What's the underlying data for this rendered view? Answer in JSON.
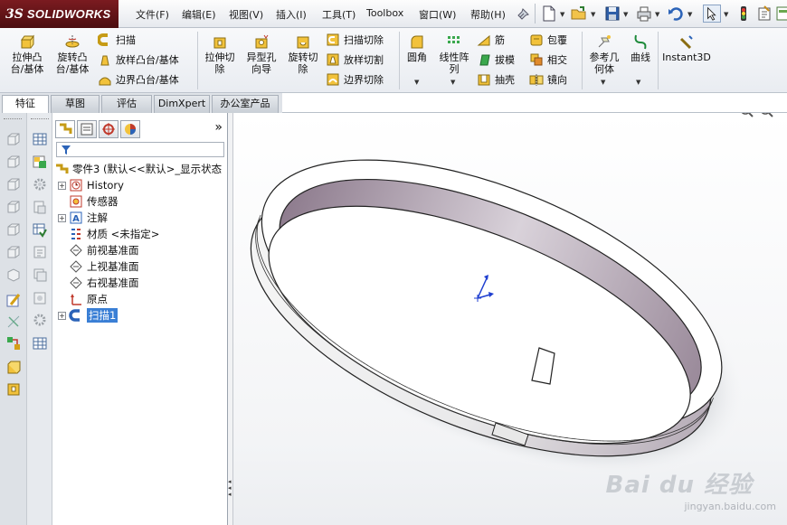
{
  "app": {
    "logo_ds": "3S",
    "logo_word": "SOLIDWORKS",
    "brand_color": "#6a1419"
  },
  "menu": [
    "文件(F)",
    "编辑(E)",
    "视图(V)",
    "插入(I)",
    "工具(T)",
    "Toolbox",
    "窗口(W)",
    "帮助(H)"
  ],
  "commands": {
    "extrude_boss": "拉伸凸\n台/基体",
    "revolve_boss": "旋转凸\n台/基体",
    "sweep": "扫描",
    "loft": "放样凸台/基体",
    "boundary_boss": "边界凸台/基体",
    "extrude_cut": "拉伸切\n除",
    "hole_wizard": "异型孔\n向导",
    "revolve_cut": "旋转切\n除",
    "sweep_cut": "扫描切除",
    "loft_cut": "放样切割",
    "boundary_cut": "边界切除",
    "fillet": "圆角",
    "linear_pattern": "线性阵\n列",
    "rib": "筋",
    "draft": "拔模",
    "shell": "抽壳",
    "wrap": "包覆",
    "intersect": "相交",
    "mirror": "镜向",
    "ref_geometry": "参考几\n何体",
    "curves": "曲线",
    "instant3d": "Instant3D"
  },
  "tabs": [
    "特征",
    "草图",
    "评估",
    "DimXpert",
    "办公室产品"
  ],
  "active_tab": "特征",
  "tree": {
    "root": "零件3 (默认<<默认>_显示状态",
    "items": [
      {
        "label": "History",
        "expandable": true,
        "icon": "history-icon"
      },
      {
        "label": "传感器",
        "expandable": false,
        "icon": "sensor-icon"
      },
      {
        "label": "注解",
        "expandable": true,
        "icon": "annotation-icon"
      },
      {
        "label": "材质 <未指定>",
        "expandable": false,
        "icon": "material-icon"
      },
      {
        "label": "前视基准面",
        "expandable": false,
        "icon": "plane-icon"
      },
      {
        "label": "上视基准面",
        "expandable": false,
        "icon": "plane-icon"
      },
      {
        "label": "右视基准面",
        "expandable": false,
        "icon": "plane-icon"
      },
      {
        "label": "原点",
        "expandable": false,
        "icon": "origin-icon"
      },
      {
        "label": "扫描1",
        "expandable": true,
        "icon": "sweep-feature-icon",
        "selected": true
      }
    ]
  },
  "panel_collapse": "»",
  "watermark": {
    "main": "Bai du 经验",
    "sub": "jingyan.baidu.com"
  }
}
